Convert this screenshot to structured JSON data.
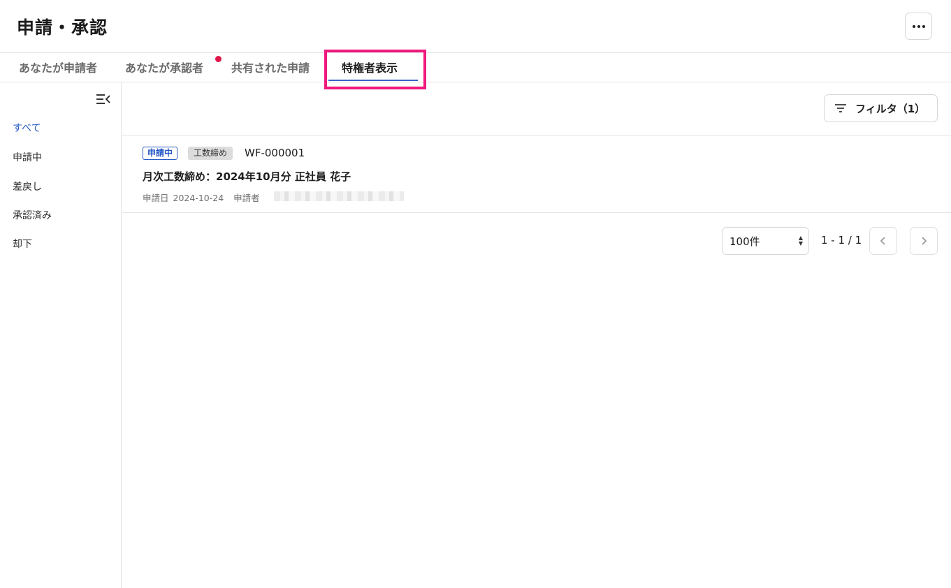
{
  "header": {
    "title": "申請・承認",
    "more_icon": "more-horizontal-icon"
  },
  "tabs": [
    {
      "label": "あなたが申請者"
    },
    {
      "label": "あなたが承認者",
      "notification_dot": true
    },
    {
      "label": "共有された申請"
    },
    {
      "label": "特権者表示",
      "active": true
    }
  ],
  "sidebar": {
    "collapse_icon": "collapse-menu-icon",
    "items": [
      {
        "label": "すべて",
        "active": true
      },
      {
        "label": "申請中"
      },
      {
        "label": "差戻し"
      },
      {
        "label": "承認済み"
      },
      {
        "label": "却下"
      }
    ]
  },
  "toolbar": {
    "filter_label": "フィルタ（1）",
    "filter_icon": "filter-icon"
  },
  "requests": [
    {
      "status": "申請中",
      "type": "工数締め",
      "id": "WF-000001",
      "title": "月次工数締め：2024年10月分 正社員 花子",
      "date_label": "申請日",
      "date": "2024-10-24",
      "applicant_label": "申請者"
    }
  ],
  "pagination": {
    "per_page": "100件",
    "range": "1 - 1 / 1",
    "prev_icon": "chevron-left-icon",
    "next_icon": "chevron-right-icon"
  },
  "colors": {
    "accent": "#2458c6",
    "highlight": "#f0197d",
    "notification": "#e0164a"
  }
}
